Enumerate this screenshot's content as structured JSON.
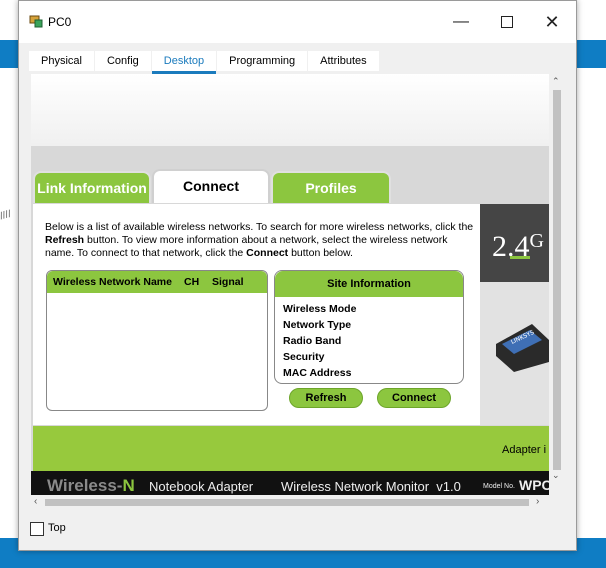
{
  "window": {
    "title": "PC0"
  },
  "tabs": [
    "Physical",
    "Config",
    "Desktop",
    "Programming",
    "Attributes"
  ],
  "active_tab": "Desktop",
  "wireless_app": {
    "subtabs": [
      "Link Information",
      "Connect",
      "Profiles"
    ],
    "description_parts": [
      "Below is a list of available wireless networks. To search for more wireless networks, click the ",
      "Refresh",
      " button. To view more information about a network, select the wireless network name. To connect to that network, click the ",
      "Connect",
      " button below."
    ],
    "list_headers": [
      "Wireless Network Name",
      "CH",
      "Signal"
    ],
    "site_info": {
      "title": "Site Information",
      "fields": [
        "Wireless Mode",
        "Network Type",
        "Radio Band",
        "Security",
        "MAC Address"
      ]
    },
    "buttons": {
      "refresh": "Refresh",
      "connect": "Connect"
    },
    "side_badge": "2.4",
    "side_badge_sup": "G",
    "adapter_text": "Adapter i",
    "footer": {
      "brand_part1": "Wireless-",
      "brand_part2": "N",
      "notebook": "Notebook Adapter",
      "monitor": "Wireless Network Monitor  v1.0",
      "model_label": "Model No.",
      "model_value": "WPC"
    }
  },
  "top_checkbox_label": "Top",
  "colors": {
    "accent": "#1b7bbd",
    "green": "#8cc63f",
    "dark_green": "#97c93d",
    "footer_bg": "#111111",
    "blue_band": "#0f7dc4"
  }
}
